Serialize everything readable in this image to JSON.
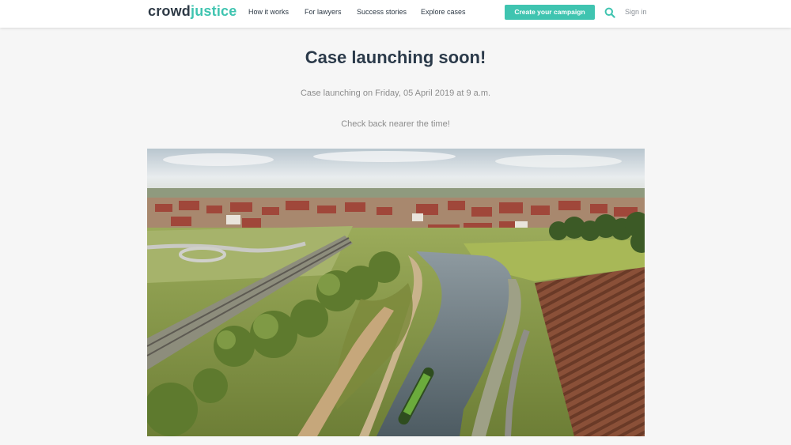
{
  "header": {
    "logo": {
      "part1": "crowd",
      "part2": "justice"
    },
    "nav": [
      {
        "label": "How it works"
      },
      {
        "label": "For lawyers"
      },
      {
        "label": "Success stories"
      },
      {
        "label": "Explore cases"
      }
    ],
    "create_button": "Create your campaign",
    "sign_in": "Sign in"
  },
  "main": {
    "title": "Case launching soon!",
    "launch_text": "Case launching on Friday, 05 April 2019 at 9 a.m.",
    "check_back": "Check back nearer the time!"
  },
  "colors": {
    "brand_teal": "#3fc4b0",
    "dark_navy": "#2b3a4a",
    "page_bg": "#f6f6f6"
  },
  "icons": [
    "search-icon"
  ]
}
